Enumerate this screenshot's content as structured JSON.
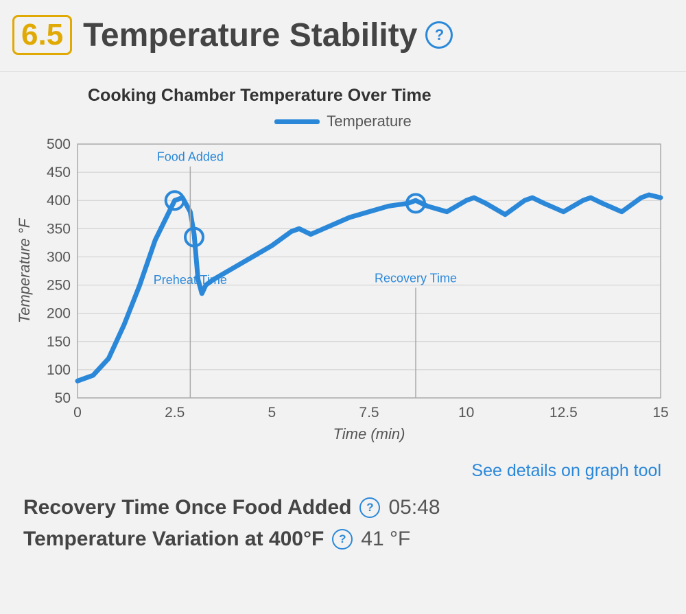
{
  "header": {
    "score": "6.5",
    "title": "Temperature Stability"
  },
  "legend": {
    "label": "Temperature"
  },
  "link": {
    "label": "See details on graph tool"
  },
  "stats": {
    "recovery": {
      "label": "Recovery Time Once Food Added",
      "value": "05:48"
    },
    "variation": {
      "label": "Temperature Variation at 400°F",
      "value": "41 °F"
    }
  },
  "chart_data": {
    "type": "line",
    "title": "Cooking Chamber Temperature Over Time",
    "xlabel": "Time (min)",
    "ylabel": "Temperature °F",
    "xlim": [
      0,
      15
    ],
    "ylim": [
      50,
      500
    ],
    "xticks": [
      0,
      2.5,
      5,
      7.5,
      10,
      12.5,
      15
    ],
    "yticks": [
      50,
      100,
      150,
      200,
      250,
      300,
      350,
      400,
      450,
      500
    ],
    "series": [
      {
        "name": "Temperature",
        "color": "#2b88d9",
        "x": [
          0.0,
          0.4,
          0.8,
          1.2,
          1.6,
          2.0,
          2.5,
          2.7,
          2.9,
          3.0,
          3.1,
          3.2,
          3.3,
          3.5,
          4.0,
          4.5,
          5.0,
          5.5,
          5.7,
          6.0,
          6.5,
          7.0,
          7.5,
          8.0,
          8.5,
          8.7,
          9.0,
          9.5,
          10.0,
          10.2,
          10.5,
          11.0,
          11.5,
          11.7,
          12.0,
          12.5,
          13.0,
          13.2,
          13.5,
          14.0,
          14.5,
          14.7,
          15.0
        ],
        "y": [
          80,
          90,
          120,
          180,
          250,
          330,
          400,
          405,
          380,
          340,
          260,
          235,
          250,
          260,
          280,
          300,
          320,
          345,
          350,
          340,
          355,
          370,
          380,
          390,
          395,
          400,
          390,
          380,
          400,
          405,
          395,
          375,
          400,
          405,
          395,
          380,
          400,
          405,
          395,
          380,
          405,
          410,
          405
        ]
      }
    ],
    "annotations": [
      {
        "label": "Food Added",
        "x": 2.9,
        "y": 470,
        "marker_x": 2.5,
        "marker_y": 400,
        "stem_to_x": true
      },
      {
        "label": "Preheat Time",
        "x": 2.9,
        "y": 252,
        "marker_x": 3.0,
        "marker_y": 335
      },
      {
        "label": "Recovery Time",
        "x": 8.7,
        "y": 255,
        "marker_x": 8.7,
        "marker_y": 395,
        "stem_to_x": true
      }
    ]
  }
}
